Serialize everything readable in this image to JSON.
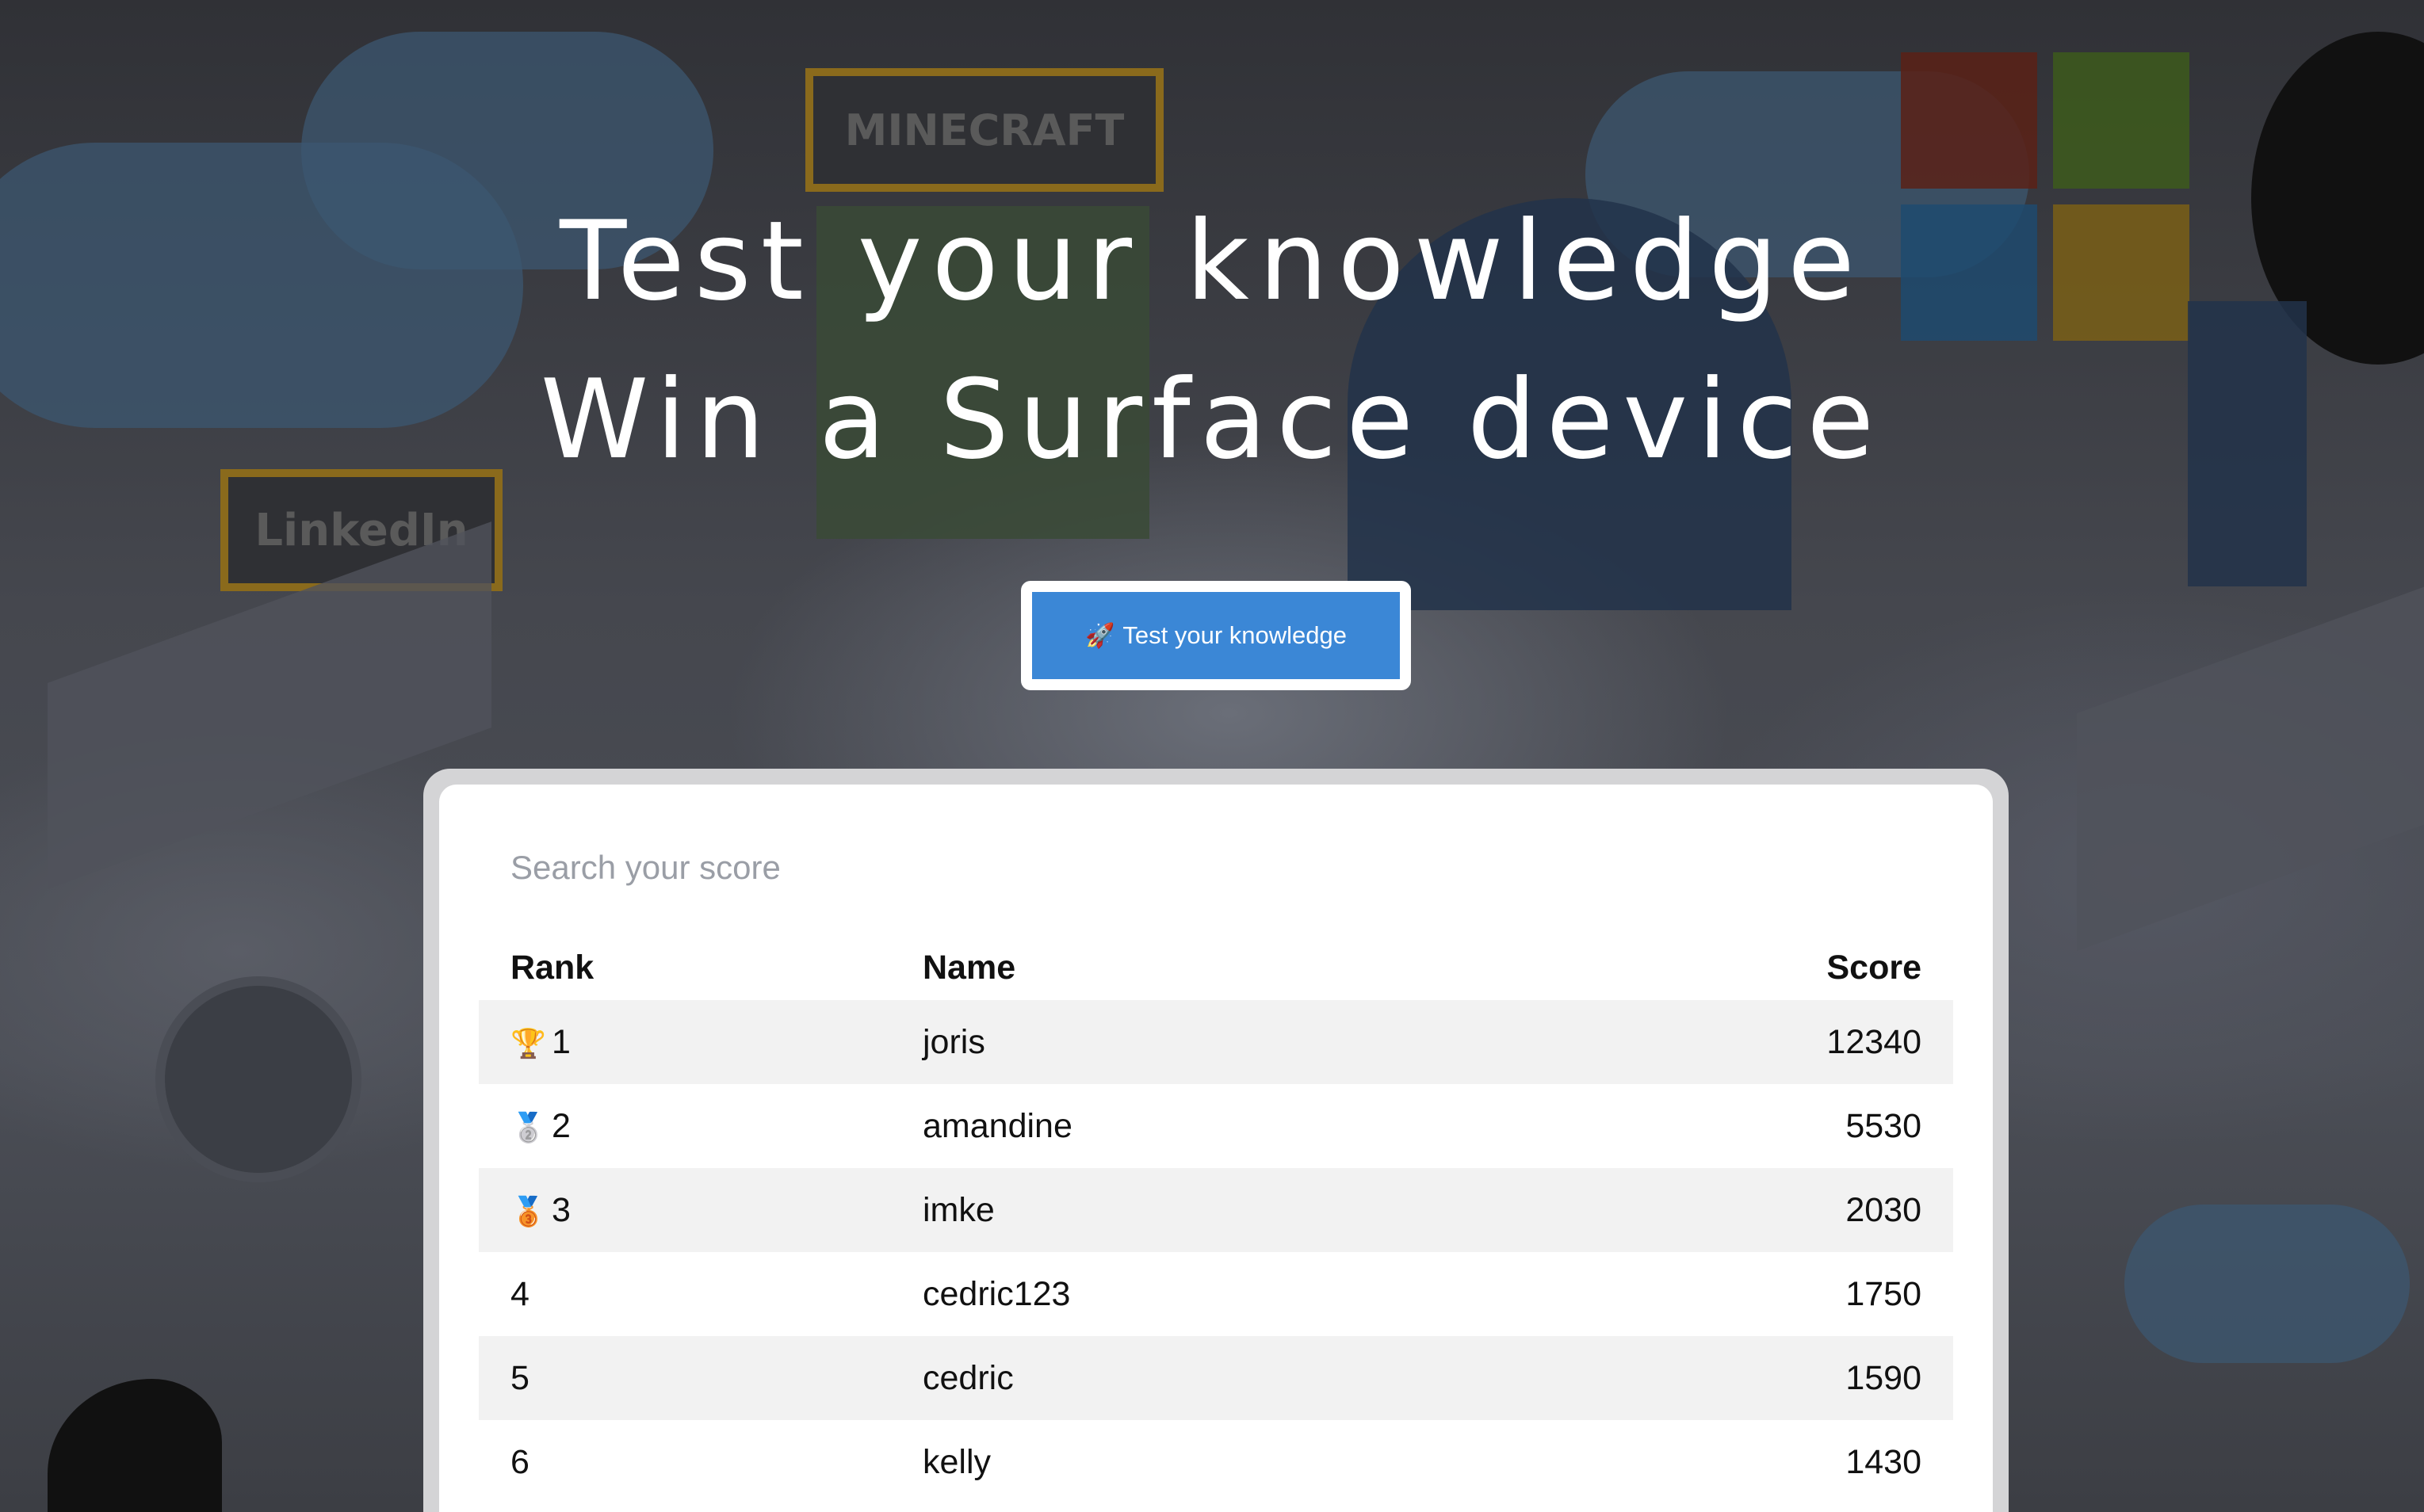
{
  "hero": {
    "title_line1": "Test your knowledge",
    "title_line2": "Win a Surface device",
    "cta_label": "Test your knowledge",
    "cta_icon": "rocket-icon"
  },
  "leaderboard": {
    "search_placeholder": "Search your score",
    "columns": {
      "rank": "Rank",
      "name": "Name",
      "score": "Score"
    },
    "rows": [
      {
        "rank": "1",
        "medal": "🏆",
        "name": "joris",
        "score": "12340"
      },
      {
        "rank": "2",
        "medal": "🥈",
        "name": "amandine",
        "score": "5530"
      },
      {
        "rank": "3",
        "medal": "🥉",
        "name": "imke",
        "score": "2030"
      },
      {
        "rank": "4",
        "medal": "",
        "name": "cedric123",
        "score": "1750"
      },
      {
        "rank": "5",
        "medal": "",
        "name": "cedric",
        "score": "1590"
      },
      {
        "rank": "6",
        "medal": "",
        "name": "kelly",
        "score": "1430"
      }
    ]
  },
  "background": {
    "logos": [
      "MINECRAFT",
      "LinkedIn"
    ],
    "colors": {
      "cta": "#3b87d6",
      "ms_red": "#5a2116",
      "ms_green": "#3d5a1c",
      "ms_blue": "#1e4a6e",
      "ms_yellow": "#7a5f16"
    }
  }
}
